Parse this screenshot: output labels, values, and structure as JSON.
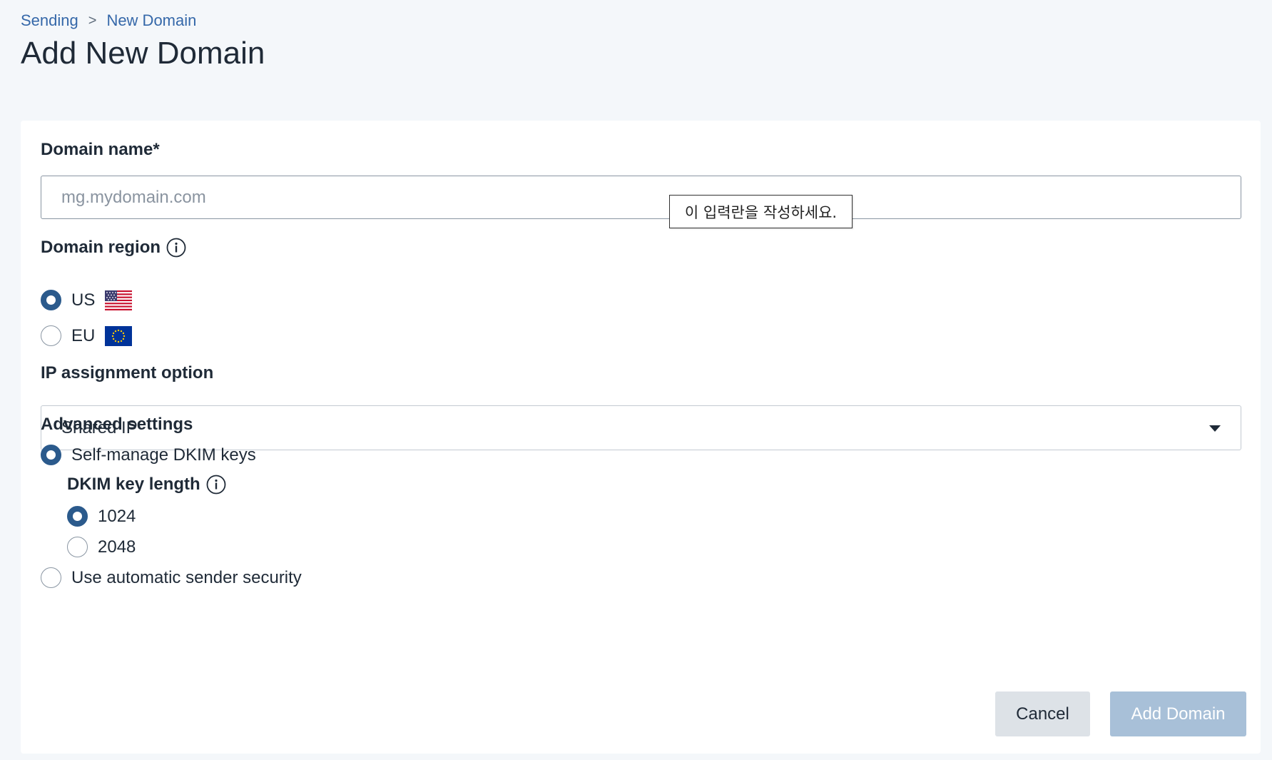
{
  "breadcrumb": {
    "items": [
      "Sending",
      "New Domain"
    ],
    "separator": ">"
  },
  "page": {
    "title": "Add New Domain"
  },
  "form": {
    "domain_name": {
      "label": "Domain name*",
      "placeholder": "mg.mydomain.com",
      "value": "",
      "validation_tooltip": "이 입력란을 작성하세요."
    },
    "domain_region": {
      "label": "Domain region",
      "options": [
        {
          "label": "US",
          "flag": "us-flag-icon",
          "checked": true
        },
        {
          "label": "EU",
          "flag": "eu-flag-icon",
          "checked": false
        }
      ]
    },
    "ip_assignment": {
      "label": "IP assignment option",
      "selected": "Shared IP"
    },
    "advanced": {
      "label": "Advanced settings",
      "self_manage_label": "Self-manage DKIM keys",
      "self_manage_checked": true,
      "dkim_key_length_label": "DKIM key length",
      "key_lengths": [
        {
          "label": "1024",
          "checked": true
        },
        {
          "label": "2048",
          "checked": false
        }
      ],
      "automatic_label": "Use automatic sender security",
      "automatic_checked": false
    },
    "buttons": {
      "cancel": "Cancel",
      "add": "Add Domain"
    }
  },
  "colors": {
    "link": "#3568a9",
    "radio_checked": "#2b5a8c",
    "add_button_disabled": "#a8c0d8",
    "cancel_button": "#dde2e7"
  }
}
